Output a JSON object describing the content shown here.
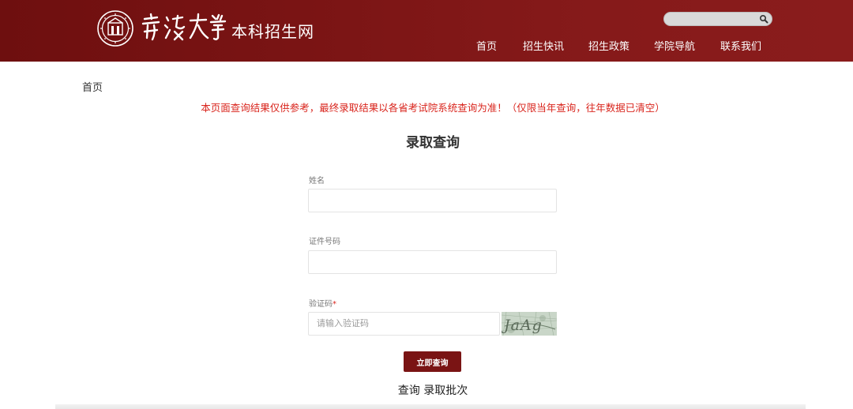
{
  "header": {
    "site_name": "本科招生网",
    "logo_calligraphy": "宁波大学",
    "search": {
      "value": "",
      "placeholder": ""
    },
    "nav": [
      {
        "label": "首页"
      },
      {
        "label": "招生快讯"
      },
      {
        "label": "招生政策"
      },
      {
        "label": "学院导航"
      },
      {
        "label": "联系我们"
      }
    ]
  },
  "breadcrumb": "首页",
  "notice": "本页面查询结果仅供参考，最终录取结果以各省考试院系统查询为准！（仅限当年查询，往年数据已清空）",
  "title": "录取查询",
  "form": {
    "name_label": "姓名",
    "name_value": "",
    "id_label": "证件号码",
    "id_value": "",
    "captcha_label": "验证码",
    "captcha_required_mark": "*",
    "captcha_placeholder": "请输入验证码",
    "captcha_text": "JaAg",
    "submit_label": "立即查询"
  },
  "footer_link": "查询 录取批次",
  "colors": {
    "header_bg": "#7a1414",
    "notice": "#d9251d",
    "button_bg": "#7a1414"
  }
}
